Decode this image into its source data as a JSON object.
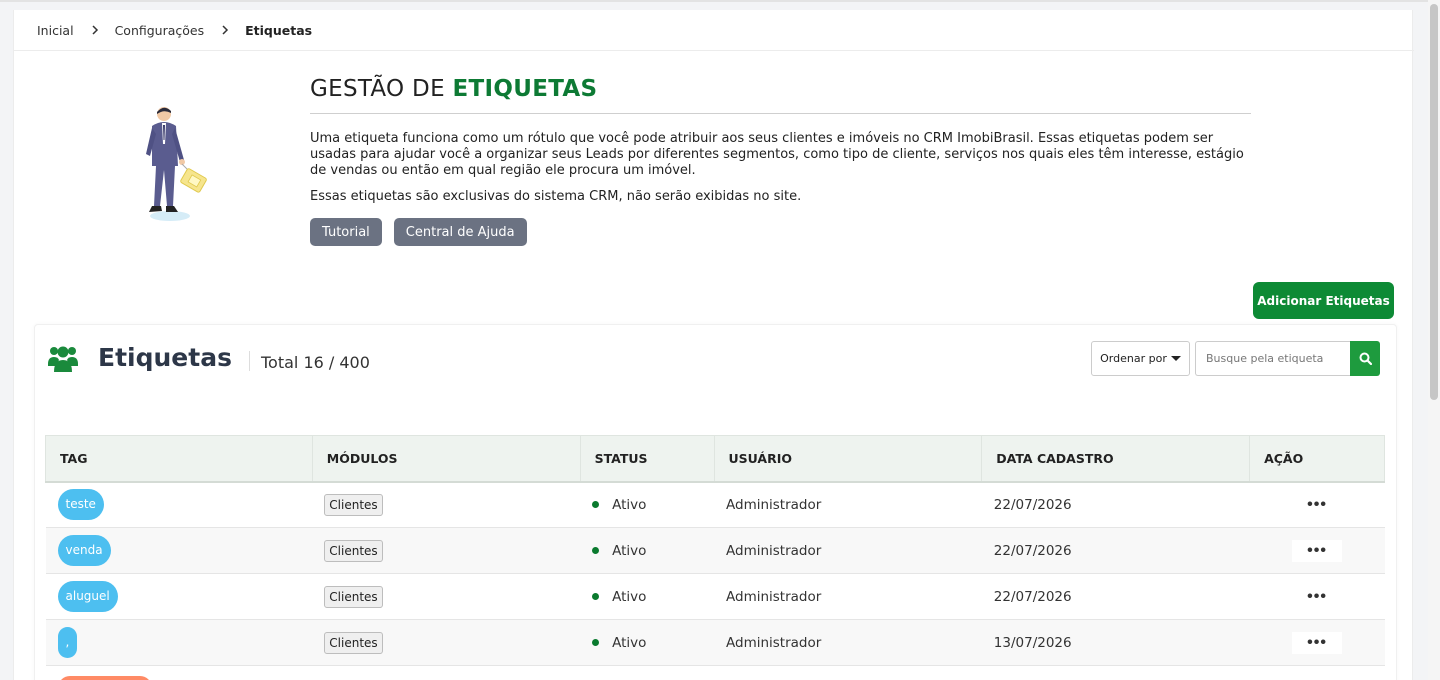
{
  "breadcrumb": {
    "home": "Inicial",
    "settings": "Configurações",
    "current": "Etiquetas"
  },
  "intro": {
    "title_prefix": "GESTÃO DE ",
    "title_accent": "ETIQUETAS",
    "description": "Uma etiqueta funciona como um rótulo que você pode atribuir aos seus clientes e imóveis no CRM ImobiBrasil. Essas etiquetas podem ser usadas para ajudar você a organizar seus Leads por diferentes segmentos, como tipo de cliente, serviços nos quais eles têm interesse, estágio de vendas ou então em qual região ele procura um imóvel.",
    "note": "Essas etiquetas são exclusivas do sistema CRM, não serão exibidas no site.",
    "tutorial_label": "Tutorial",
    "help_label": "Central de Ajuda"
  },
  "add_button_label": "Adicionar Etiquetas",
  "card": {
    "title": "Etiquetas",
    "total": "Total 16 / 400",
    "sort_label": "Ordenar por",
    "search_placeholder": "Busque pela etiqueta"
  },
  "table": {
    "headers": {
      "tag": "TAG",
      "modules": "MÓDULOS",
      "status": "STATUS",
      "user": "USUÁRIO",
      "date": "DATA CADASTRO",
      "action": "AÇÃO"
    },
    "rows": [
      {
        "tag": "teste",
        "module": "Clientes",
        "status": "Ativo",
        "user": "Administrador",
        "date": "22/07/2026",
        "action": "•••"
      },
      {
        "tag": "venda",
        "module": "Clientes",
        "status": "Ativo",
        "user": "Administrador",
        "date": "22/07/2026",
        "action": "•••"
      },
      {
        "tag": "aluguel",
        "module": "Clientes",
        "status": "Ativo",
        "user": "Administrador",
        "date": "22/07/2026",
        "action": "•••"
      },
      {
        "tag": ",",
        "module": "Clientes",
        "status": "Ativo",
        "user": "Administrador",
        "date": "13/07/2026",
        "action": "•••"
      }
    ]
  },
  "colors": {
    "accent_green": "#0d7a34",
    "add_button": "#0d8a35",
    "tag_blue": "#4dbff0",
    "tag_orange": "#ff8a65",
    "gray_button": "#6b7282"
  }
}
